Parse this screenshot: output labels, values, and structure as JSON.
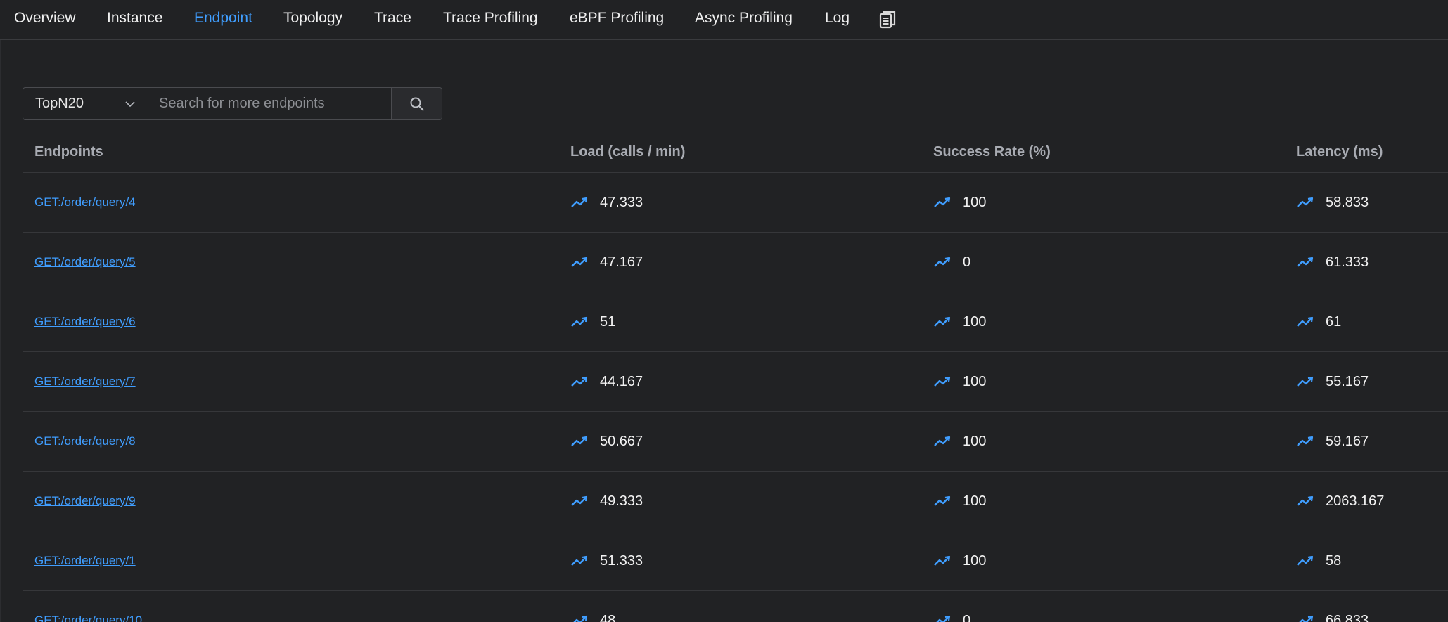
{
  "tabs": [
    {
      "label": "Overview",
      "active": false
    },
    {
      "label": "Instance",
      "active": false
    },
    {
      "label": "Endpoint",
      "active": true
    },
    {
      "label": "Topology",
      "active": false
    },
    {
      "label": "Trace",
      "active": false
    },
    {
      "label": "Trace Profiling",
      "active": false
    },
    {
      "label": "eBPF Profiling",
      "active": false
    },
    {
      "label": "Async Profiling",
      "active": false
    },
    {
      "label": "Log",
      "active": false
    }
  ],
  "tab_extra_icon": "copy-icon",
  "search": {
    "select_value": "TopN20",
    "placeholder": "Search for more endpoints",
    "value": ""
  },
  "table": {
    "headers": {
      "endpoint": "Endpoints",
      "load": "Load (calls / min)",
      "success_rate": "Success Rate (%)",
      "latency": "Latency (ms)"
    },
    "rows": [
      {
        "endpoint": "GET:/order/query/4",
        "load": "47.333",
        "success_rate": "100",
        "latency": "58.833"
      },
      {
        "endpoint": "GET:/order/query/5",
        "load": "47.167",
        "success_rate": "0",
        "latency": "61.333"
      },
      {
        "endpoint": "GET:/order/query/6",
        "load": "51",
        "success_rate": "100",
        "latency": "61"
      },
      {
        "endpoint": "GET:/order/query/7",
        "load": "44.167",
        "success_rate": "100",
        "latency": "55.167"
      },
      {
        "endpoint": "GET:/order/query/8",
        "load": "50.667",
        "success_rate": "100",
        "latency": "59.167"
      },
      {
        "endpoint": "GET:/order/query/9",
        "load": "49.333",
        "success_rate": "100",
        "latency": "2063.167"
      },
      {
        "endpoint": "GET:/order/query/1",
        "load": "51.333",
        "success_rate": "100",
        "latency": "58"
      },
      {
        "endpoint": "GET:/order/query/10",
        "load": "48",
        "success_rate": "0",
        "latency": "66.833"
      }
    ]
  },
  "colors": {
    "background": "#212224",
    "accent": "#409eff",
    "text": "#f0f0f0",
    "header_text": "#a8abb2",
    "border": "#3a3b3e"
  },
  "icons": {
    "select_toggle": "chevron-down-icon",
    "search_button": "search-icon",
    "metric_trend": "trend-line-icon"
  }
}
